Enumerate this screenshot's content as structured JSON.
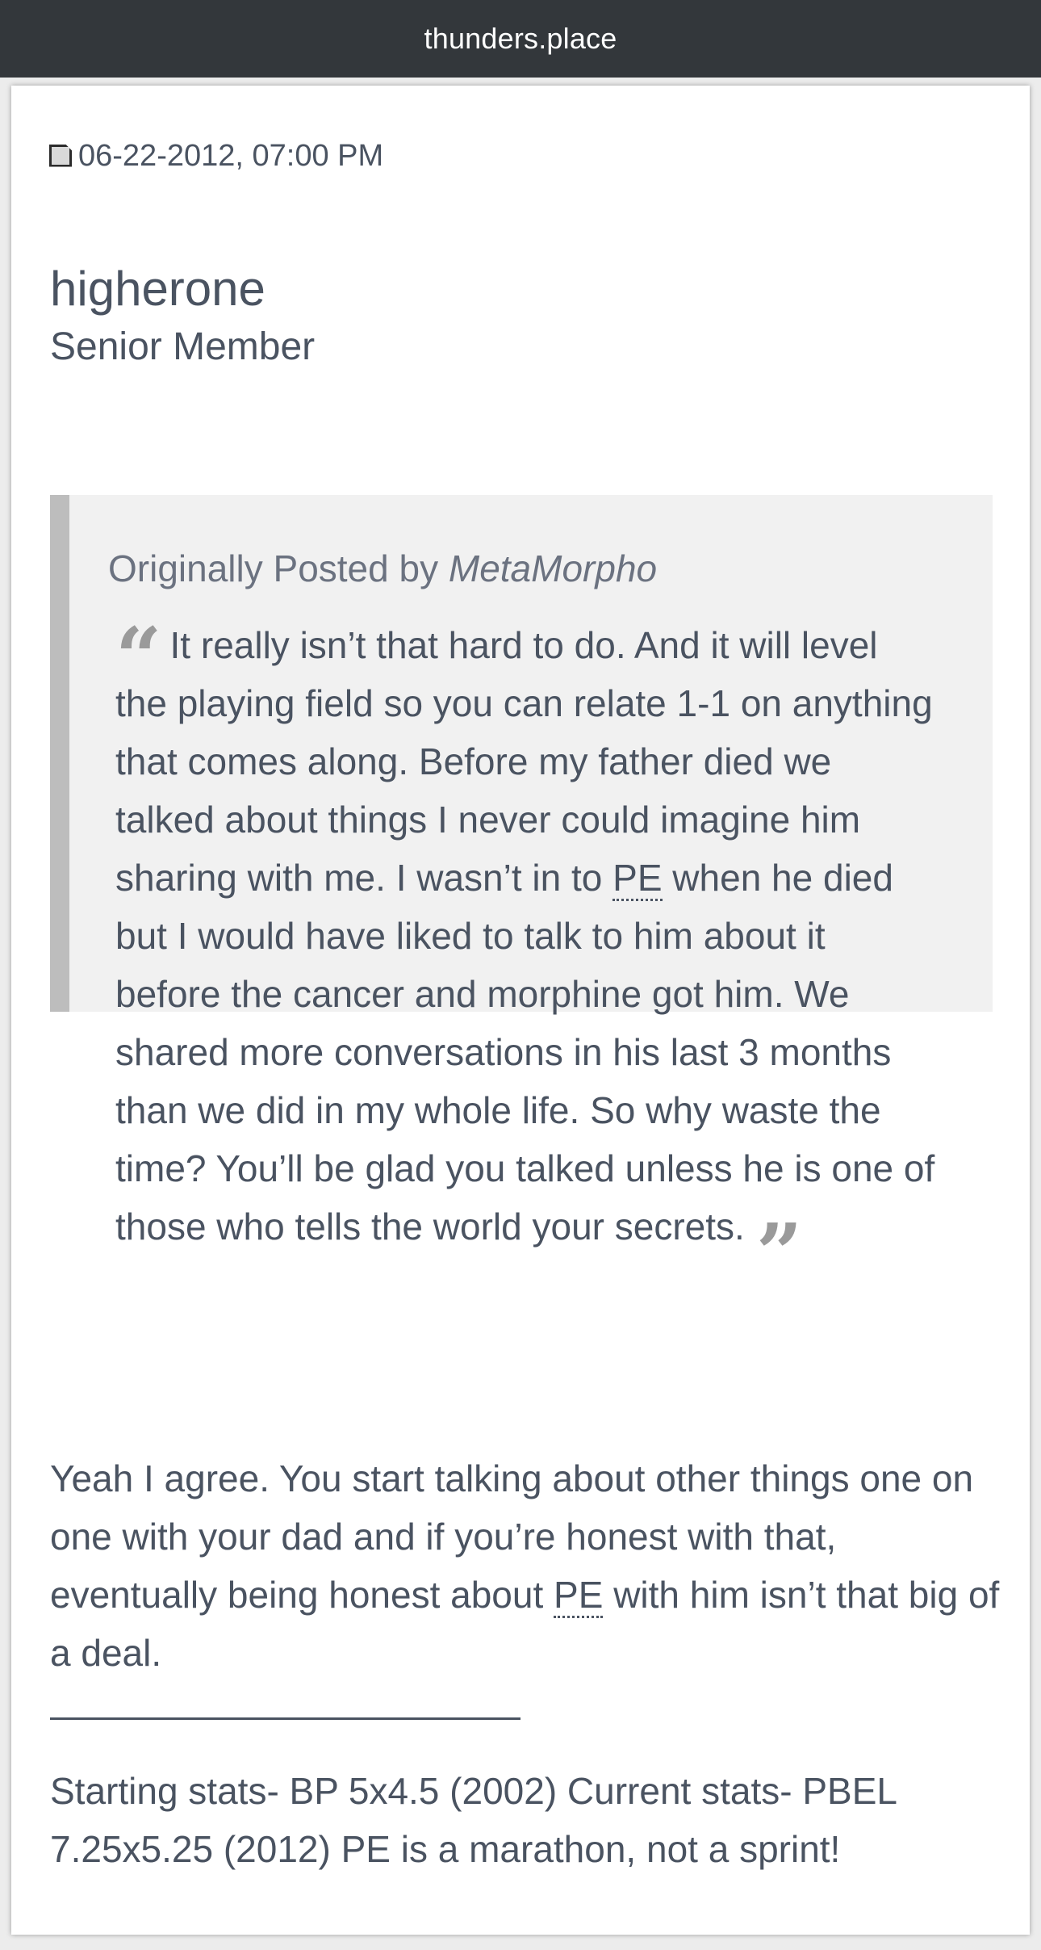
{
  "browser": {
    "url": "thunders.place"
  },
  "post": {
    "date": "06-22-2012, 07:00 PM",
    "icon": "post-icon",
    "author": {
      "username": "higherone",
      "title": "Senior Member"
    },
    "quote": {
      "attribution_prefix": "Originally Posted by",
      "attribution_author": "MetaMorpho",
      "open_mark": "“",
      "close_mark": "”",
      "text_before_abbr": "It really isn’t that hard to do. And it will level the playing field so you can relate 1-1 on anything that comes along. Before my father died we talked about things I never could imagine him sharing with me. I wasn’t in to ",
      "abbr": "PE",
      "text_after_abbr": " when he died but I would have liked to talk to him about it before the cancer and morphine got him. We shared more conversations in his last 3 months than we did in my whole life. So why waste the time? You’ll be glad you talked unless he is one of those who tells the world your secrets."
    },
    "reply": {
      "text_before_abbr": "Yeah I agree. You start talking about other things one on one with your dad and if you’re honest with that, eventually being honest about ",
      "abbr": "PE",
      "text_after_abbr": " with him isn’t that big of a deal."
    },
    "signature": "Starting stats- BP 5x4.5 (2002) Current stats- PBEL 7.25x5.25 (2012) PE is a marathon, not a sprint!"
  },
  "colors": {
    "topbar": "#33373b",
    "text": "#4a5361",
    "quote_bg": "#f1f1f1",
    "quote_border": "#bdbdbd"
  }
}
